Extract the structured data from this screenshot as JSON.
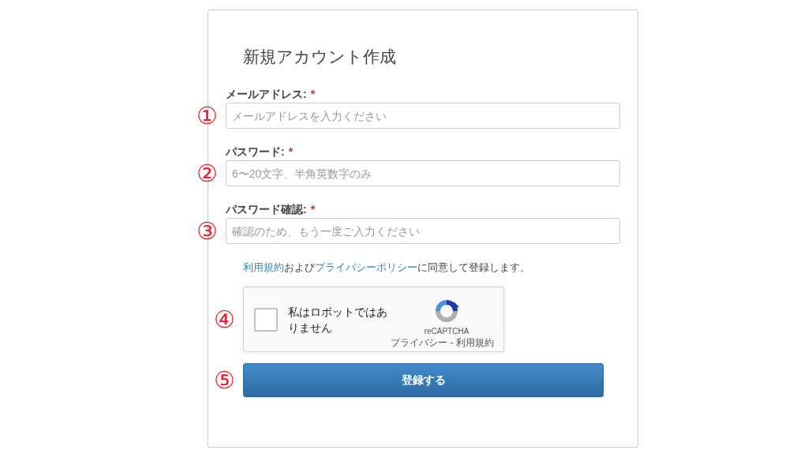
{
  "title": "新規アカウント作成",
  "fields": [
    {
      "label": "メールアドレス:",
      "required": true,
      "required_mark": "*",
      "placeholder": "メールアドレスを入力ください",
      "marker": "①"
    },
    {
      "label": "パスワード:",
      "required": true,
      "required_mark": "*",
      "placeholder": "6〜20文字、半角英数字のみ",
      "marker": "②"
    },
    {
      "label": "パスワード確認:",
      "required": true,
      "required_mark": "*",
      "placeholder": "確認のため、もう一度ご入力ください",
      "marker": "③"
    }
  ],
  "terms": [
    {
      "kind": "link",
      "text": "利用規約"
    },
    {
      "kind": "text",
      "text": "および"
    },
    {
      "kind": "link",
      "text": "プライバシーポリシー"
    },
    {
      "kind": "text",
      "text": "に同意して登録します。"
    }
  ],
  "captcha": {
    "label": "私はロボットではありません",
    "checked": false,
    "brand": "reCAPTCHA",
    "links": "プライバシー - 利用規約",
    "marker": "④"
  },
  "submit": {
    "label": "登録する",
    "marker": "⑤"
  }
}
